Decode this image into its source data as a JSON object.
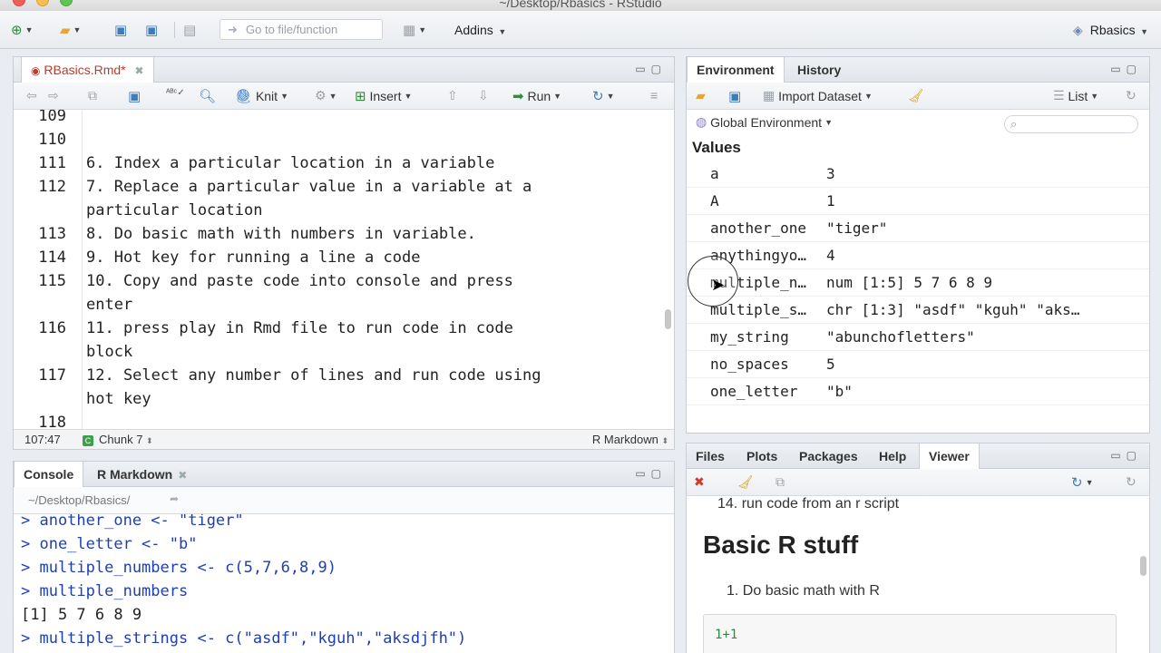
{
  "window": {
    "title": "~/Desktop/Rbasics - RStudio"
  },
  "toolbar": {
    "goto_placeholder": "Go to file/function",
    "addins_label": "Addins",
    "project_label": "Rbasics"
  },
  "editor": {
    "tab_label": "RBasics.Rmd*",
    "knit_label": "Knit",
    "insert_label": "Insert",
    "run_label": "Run",
    "lines": [
      {
        "num": "109",
        "text": ""
      },
      {
        "num": "110",
        "text": ""
      },
      {
        "num": "111",
        "text": "6. Index a particular location in a variable"
      },
      {
        "num": "112",
        "text": "7. Replace a particular value in a variable at a"
      },
      {
        "num": "",
        "text": "particular location"
      },
      {
        "num": "113",
        "text": "8. Do basic math with numbers in variable."
      },
      {
        "num": "114",
        "text": "9. Hot key for running a line a code"
      },
      {
        "num": "115",
        "text": "10. Copy and paste code into console and press"
      },
      {
        "num": "",
        "text": "enter"
      },
      {
        "num": "116",
        "text": "11. press play in Rmd file to run code in code"
      },
      {
        "num": "",
        "text": "block"
      },
      {
        "num": "117",
        "text": "12. Select any number of lines and run code using"
      },
      {
        "num": "",
        "text": "hot key"
      },
      {
        "num": "118",
        "text": ""
      }
    ],
    "status": {
      "position": "107:47",
      "chunk": "Chunk 7",
      "mode": "R Markdown"
    }
  },
  "environment": {
    "tabs": [
      "Environment",
      "History"
    ],
    "import_label": "Import Dataset",
    "list_label": "List",
    "scope_label": "Global Environment",
    "section_header": "Values",
    "rows": [
      {
        "name": "a",
        "value": "3"
      },
      {
        "name": "A",
        "value": "1"
      },
      {
        "name": "another_one",
        "value": "\"tiger\""
      },
      {
        "name": "anythingyo…",
        "value": "4"
      },
      {
        "name": "multiple_n…",
        "value": "num [1:5] 5 7 6 8 9"
      },
      {
        "name": "multiple_s…",
        "value": "chr [1:3] \"asdf\" \"kguh\" \"aks…"
      },
      {
        "name": "my_string",
        "value": "\"abunchofletters\""
      },
      {
        "name": "no_spaces",
        "value": "5"
      },
      {
        "name": "one_letter",
        "value": "\"b\""
      }
    ]
  },
  "console": {
    "tabs": [
      "Console",
      "R Markdown"
    ],
    "path": "~/Desktop/Rbasics/",
    "lines": [
      {
        "kind": "cmd",
        "text": "> another_one <- \"tiger\""
      },
      {
        "kind": "cmd",
        "text": "> one_letter <- \"b\""
      },
      {
        "kind": "cmd",
        "text": "> multiple_numbers <- c(5,7,6,8,9)"
      },
      {
        "kind": "cmd",
        "text": "> multiple_numbers"
      },
      {
        "kind": "out",
        "text": "[1] 5 7 6 8 9"
      },
      {
        "kind": "cmd",
        "text": "> multiple_strings <- c(\"asdf\",\"kguh\",\"aksdjfh\")"
      },
      {
        "kind": "cmd",
        "text": "> "
      }
    ]
  },
  "viewer": {
    "tabs": [
      "Files",
      "Plots",
      "Packages",
      "Help",
      "Viewer"
    ],
    "list_item_14": "14.  run code from an r script",
    "heading": "Basic R stuff",
    "list_item_1": "1.  Do basic math with R",
    "code": "1+1"
  }
}
